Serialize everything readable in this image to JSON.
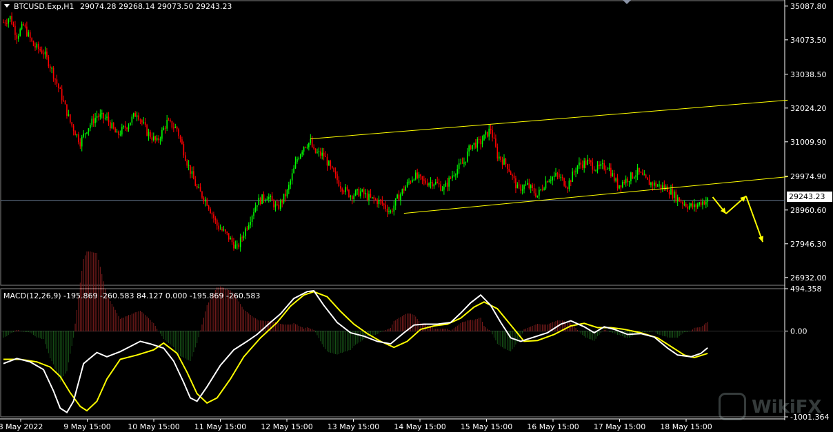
{
  "header": {
    "symbol_label": "BTCUSD.Exp,H1",
    "ohlc_label": "29074.28 29268.14 29073.50 29243.23",
    "macd_label": "MACD(12,26,9) -195.869 -260.583 84.127 0.000 -195.869 -260.583"
  },
  "colors": {
    "background": "#000000",
    "bull": "#00ff00",
    "bear": "#ff0000",
    "hist_pos": "#ff3b3b",
    "hist_neg": "#2ea82e",
    "macd_line": "#ffffff",
    "signal_line": "#ffff00",
    "channel": "#ffff00",
    "arrows": "#ffff00",
    "grid": "#ffffff"
  },
  "current_price_tag": "29243.23",
  "watermark": "WikiFX",
  "chart_data": [
    {
      "type": "candlestick",
      "title": "BTCUSD.Exp,H1",
      "y_ticks": [
        "35087.80",
        "34073.50",
        "33038.50",
        "32024.20",
        "31009.90",
        "29974.90",
        "28960.60",
        "27946.30",
        "26932.00"
      ],
      "ylim": [
        26700,
        35250
      ],
      "x_ticks": [
        "8 May 2022",
        "9 May 15:00",
        "10 May 15:00",
        "11 May 15:00",
        "12 May 15:00",
        "13 May 15:00",
        "14 May 15:00",
        "15 May 15:00",
        "16 May 15:00",
        "17 May 15:00",
        "18 May 15:00"
      ],
      "current_price": 29243.23,
      "close_path": [
        [
          0,
          34600
        ],
        [
          4,
          34750
        ],
        [
          8,
          34200
        ],
        [
          12,
          34500
        ],
        [
          18,
          33900
        ],
        [
          24,
          33700
        ],
        [
          28,
          33300
        ],
        [
          34,
          32500
        ],
        [
          40,
          31600
        ],
        [
          46,
          31000
        ],
        [
          50,
          31400
        ],
        [
          56,
          31800
        ],
        [
          62,
          31700
        ],
        [
          68,
          31200
        ],
        [
          74,
          31500
        ],
        [
          80,
          31900
        ],
        [
          86,
          31300
        ],
        [
          92,
          31000
        ],
        [
          98,
          31600
        ],
        [
          104,
          31400
        ],
        [
          110,
          30400
        ],
        [
          116,
          29600
        ],
        [
          122,
          29200
        ],
        [
          128,
          28500
        ],
        [
          134,
          28200
        ],
        [
          140,
          27800
        ],
        [
          146,
          28500
        ],
        [
          152,
          29200
        ],
        [
          158,
          29400
        ],
        [
          164,
          29000
        ],
        [
          170,
          29500
        ],
        [
          176,
          30500
        ],
        [
          180,
          30900
        ],
        [
          184,
          31000
        ],
        [
          186,
          30700
        ],
        [
          192,
          30600
        ],
        [
          196,
          30200
        ],
        [
          202,
          29700
        ],
        [
          208,
          29400
        ],
        [
          214,
          29500
        ],
        [
          220,
          29300
        ],
        [
          226,
          29200
        ],
        [
          232,
          28900
        ],
        [
          236,
          29300
        ],
        [
          240,
          29600
        ],
        [
          246,
          30000
        ],
        [
          252,
          29800
        ],
        [
          258,
          29800
        ],
        [
          264,
          29600
        ],
        [
          270,
          30100
        ],
        [
          276,
          30400
        ],
        [
          280,
          30900
        ],
        [
          286,
          31000
        ],
        [
          292,
          31400
        ],
        [
          296,
          30600
        ],
        [
          302,
          30300
        ],
        [
          308,
          29600
        ],
        [
          314,
          29700
        ],
        [
          320,
          29400
        ],
        [
          326,
          29900
        ],
        [
          332,
          30000
        ],
        [
          338,
          29700
        ],
        [
          344,
          30300
        ],
        [
          350,
          30400
        ],
        [
          356,
          30200
        ],
        [
          362,
          30300
        ],
        [
          368,
          29700
        ],
        [
          374,
          29900
        ],
        [
          380,
          30100
        ],
        [
          386,
          29800
        ],
        [
          392,
          29700
        ],
        [
          398,
          29600
        ],
        [
          404,
          29300
        ],
        [
          410,
          29100
        ],
        [
          414,
          29050
        ],
        [
          418,
          29200
        ],
        [
          422,
          29243.23
        ]
      ],
      "channel_upper": [
        [
          184,
          31100
        ],
        [
          470,
          32260
        ]
      ],
      "channel_lower": [
        [
          240,
          28860
        ],
        [
          470,
          29960
        ]
      ],
      "projected_path": [
        [
          425,
          29350
        ],
        [
          433,
          28850
        ],
        [
          445,
          29380
        ],
        [
          455,
          28000
        ]
      ]
    },
    {
      "type": "line",
      "title": "MACD(12,26,9)",
      "y_ticks": [
        "494.358",
        "0.00",
        "-1001.364"
      ],
      "ylim": [
        -1001.364,
        494.358
      ],
      "series": [
        {
          "key": "macd",
          "values": [
            [
              0,
              -380
            ],
            [
              8,
              -320
            ],
            [
              16,
              -360
            ],
            [
              24,
              -450
            ],
            [
              30,
              -700
            ],
            [
              34,
              -900
            ],
            [
              38,
              -950
            ],
            [
              42,
              -820
            ],
            [
              48,
              -380
            ],
            [
              56,
              -250
            ],
            [
              62,
              -300
            ],
            [
              70,
              -240
            ],
            [
              76,
              -180
            ],
            [
              82,
              -120
            ],
            [
              88,
              -150
            ],
            [
              96,
              -200
            ],
            [
              102,
              -350
            ],
            [
              108,
              -600
            ],
            [
              112,
              -780
            ],
            [
              116,
              -820
            ],
            [
              122,
              -650
            ],
            [
              130,
              -400
            ],
            [
              138,
              -220
            ],
            [
              146,
              -120
            ],
            [
              152,
              -40
            ],
            [
              160,
              100
            ],
            [
              166,
              200
            ],
            [
              174,
              380
            ],
            [
              182,
              460
            ],
            [
              186,
              470
            ],
            [
              192,
              300
            ],
            [
              200,
              100
            ],
            [
              208,
              -20
            ],
            [
              216,
              -60
            ],
            [
              224,
              -120
            ],
            [
              232,
              -150
            ],
            [
              240,
              -20
            ],
            [
              246,
              70
            ],
            [
              252,
              80
            ],
            [
              260,
              80
            ],
            [
              268,
              100
            ],
            [
              274,
              210
            ],
            [
              280,
              330
            ],
            [
              286,
              420
            ],
            [
              292,
              300
            ],
            [
              298,
              100
            ],
            [
              304,
              -80
            ],
            [
              310,
              -120
            ],
            [
              318,
              -70
            ],
            [
              326,
              -20
            ],
            [
              334,
              80
            ],
            [
              340,
              120
            ],
            [
              348,
              50
            ],
            [
              354,
              -20
            ],
            [
              360,
              50
            ],
            [
              366,
              20
            ],
            [
              374,
              -40
            ],
            [
              382,
              -30
            ],
            [
              390,
              -70
            ],
            [
              398,
              -200
            ],
            [
              404,
              -280
            ],
            [
              412,
              -300
            ],
            [
              418,
              -260
            ],
            [
              422,
              -195.869
            ]
          ]
        },
        {
          "key": "signal",
          "values": [
            [
              0,
              -330
            ],
            [
              10,
              -330
            ],
            [
              20,
              -360
            ],
            [
              28,
              -420
            ],
            [
              34,
              -530
            ],
            [
              40,
              -720
            ],
            [
              46,
              -880
            ],
            [
              50,
              -930
            ],
            [
              56,
              -820
            ],
            [
              62,
              -560
            ],
            [
              70,
              -330
            ],
            [
              80,
              -280
            ],
            [
              90,
              -220
            ],
            [
              96,
              -140
            ],
            [
              104,
              -260
            ],
            [
              110,
              -480
            ],
            [
              116,
              -730
            ],
            [
              122,
              -840
            ],
            [
              128,
              -780
            ],
            [
              136,
              -560
            ],
            [
              144,
              -300
            ],
            [
              154,
              -80
            ],
            [
              164,
              100
            ],
            [
              172,
              290
            ],
            [
              180,
              420
            ],
            [
              186,
              460
            ],
            [
              194,
              400
            ],
            [
              202,
              230
            ],
            [
              210,
              80
            ],
            [
              218,
              -30
            ],
            [
              226,
              -120
            ],
            [
              234,
              -190
            ],
            [
              242,
              -120
            ],
            [
              250,
              20
            ],
            [
              258,
              60
            ],
            [
              266,
              80
            ],
            [
              274,
              150
            ],
            [
              282,
              280
            ],
            [
              288,
              340
            ],
            [
              296,
              260
            ],
            [
              304,
              70
            ],
            [
              312,
              -120
            ],
            [
              320,
              -110
            ],
            [
              330,
              -40
            ],
            [
              340,
              60
            ],
            [
              348,
              90
            ],
            [
              356,
              40
            ],
            [
              364,
              40
            ],
            [
              372,
              20
            ],
            [
              382,
              -20
            ],
            [
              392,
              -80
            ],
            [
              400,
              -180
            ],
            [
              408,
              -280
            ],
            [
              414,
              -310
            ],
            [
              422,
              -260.583
            ]
          ]
        }
      ]
    }
  ]
}
